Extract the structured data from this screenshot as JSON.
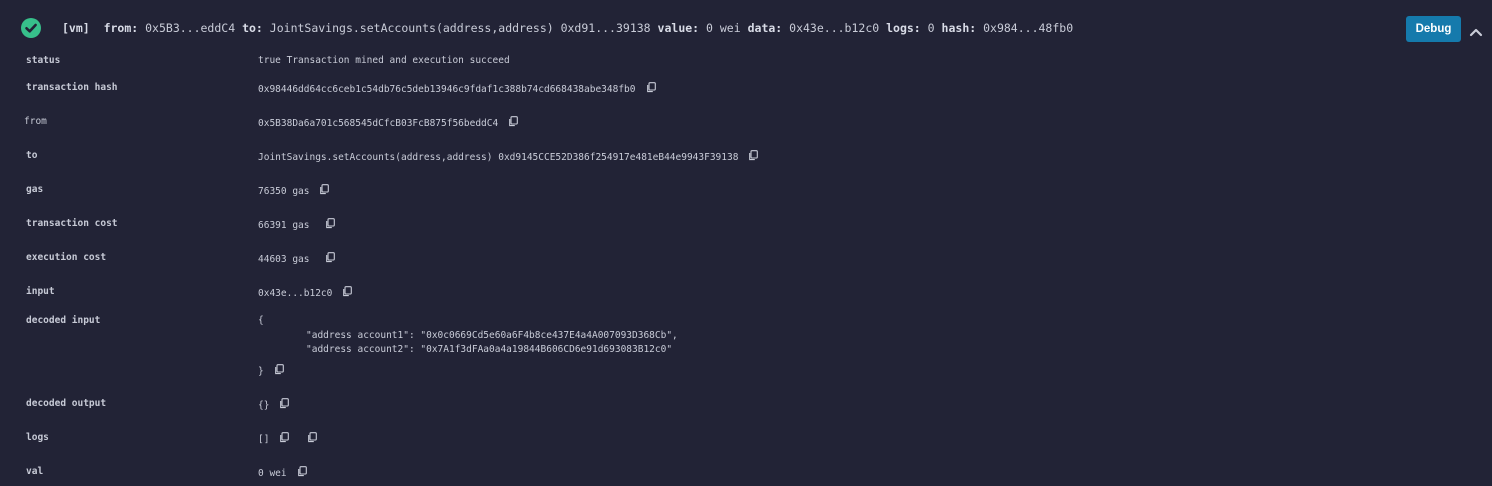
{
  "header": {
    "status_icon": "check-circle-icon",
    "env": "[vm]",
    "from_label": "from:",
    "from_value": "0x5B3...eddC4",
    "to_label": "to:",
    "to_value": "JointSavings.setAccounts(address,address) 0xd91...39138",
    "value_label": "value:",
    "value_value": "0 wei",
    "data_label": "data:",
    "data_value": "0x43e...b12c0",
    "logs_label": "logs:",
    "logs_value": "0",
    "hash_label": "hash:",
    "hash_value": "0x984...48fb0",
    "debug_label": "Debug",
    "collapse_icon": "chevron-up-icon",
    "accent_color": "#37c08b",
    "button_color": "#157aac"
  },
  "details": {
    "status": {
      "label": "status",
      "value": "true Transaction mined and execution succeed"
    },
    "transaction_hash": {
      "label": "transaction hash",
      "value": "0x98446dd64cc6ceb1c54db76c5deb13946c9fdaf1c388b74cd668438abe348fb0"
    },
    "from": {
      "label": "from",
      "value": "0x5B38Da6a701c568545dCfcB03FcB875f56beddC4"
    },
    "to": {
      "label": "to",
      "value": "JointSavings.setAccounts(address,address) 0xd9145CCE52D386f254917e481eB44e9943F39138"
    },
    "gas": {
      "label": "gas",
      "value": "76350 gas"
    },
    "transaction_cost": {
      "label": "transaction cost",
      "value": "66391 gas"
    },
    "execution_cost": {
      "label": "execution cost",
      "value": "44603 gas"
    },
    "input": {
      "label": "input",
      "value": "0x43e...b12c0"
    },
    "decoded_input": {
      "label": "decoded input",
      "open": "{",
      "line1": "\"address account1\": \"0x0c0669Cd5e60a6F4b8ce437E4a4A007093D368Cb\",",
      "line2": "\"address account2\": \"0x7A1f3dFAa0a4a19844B606CD6e91d693083B12c0\"",
      "close": "}"
    },
    "decoded_output": {
      "label": "decoded output",
      "value": "{}"
    },
    "logs": {
      "label": "logs",
      "value": "[]"
    },
    "val": {
      "label": "val",
      "value": "0 wei"
    }
  }
}
